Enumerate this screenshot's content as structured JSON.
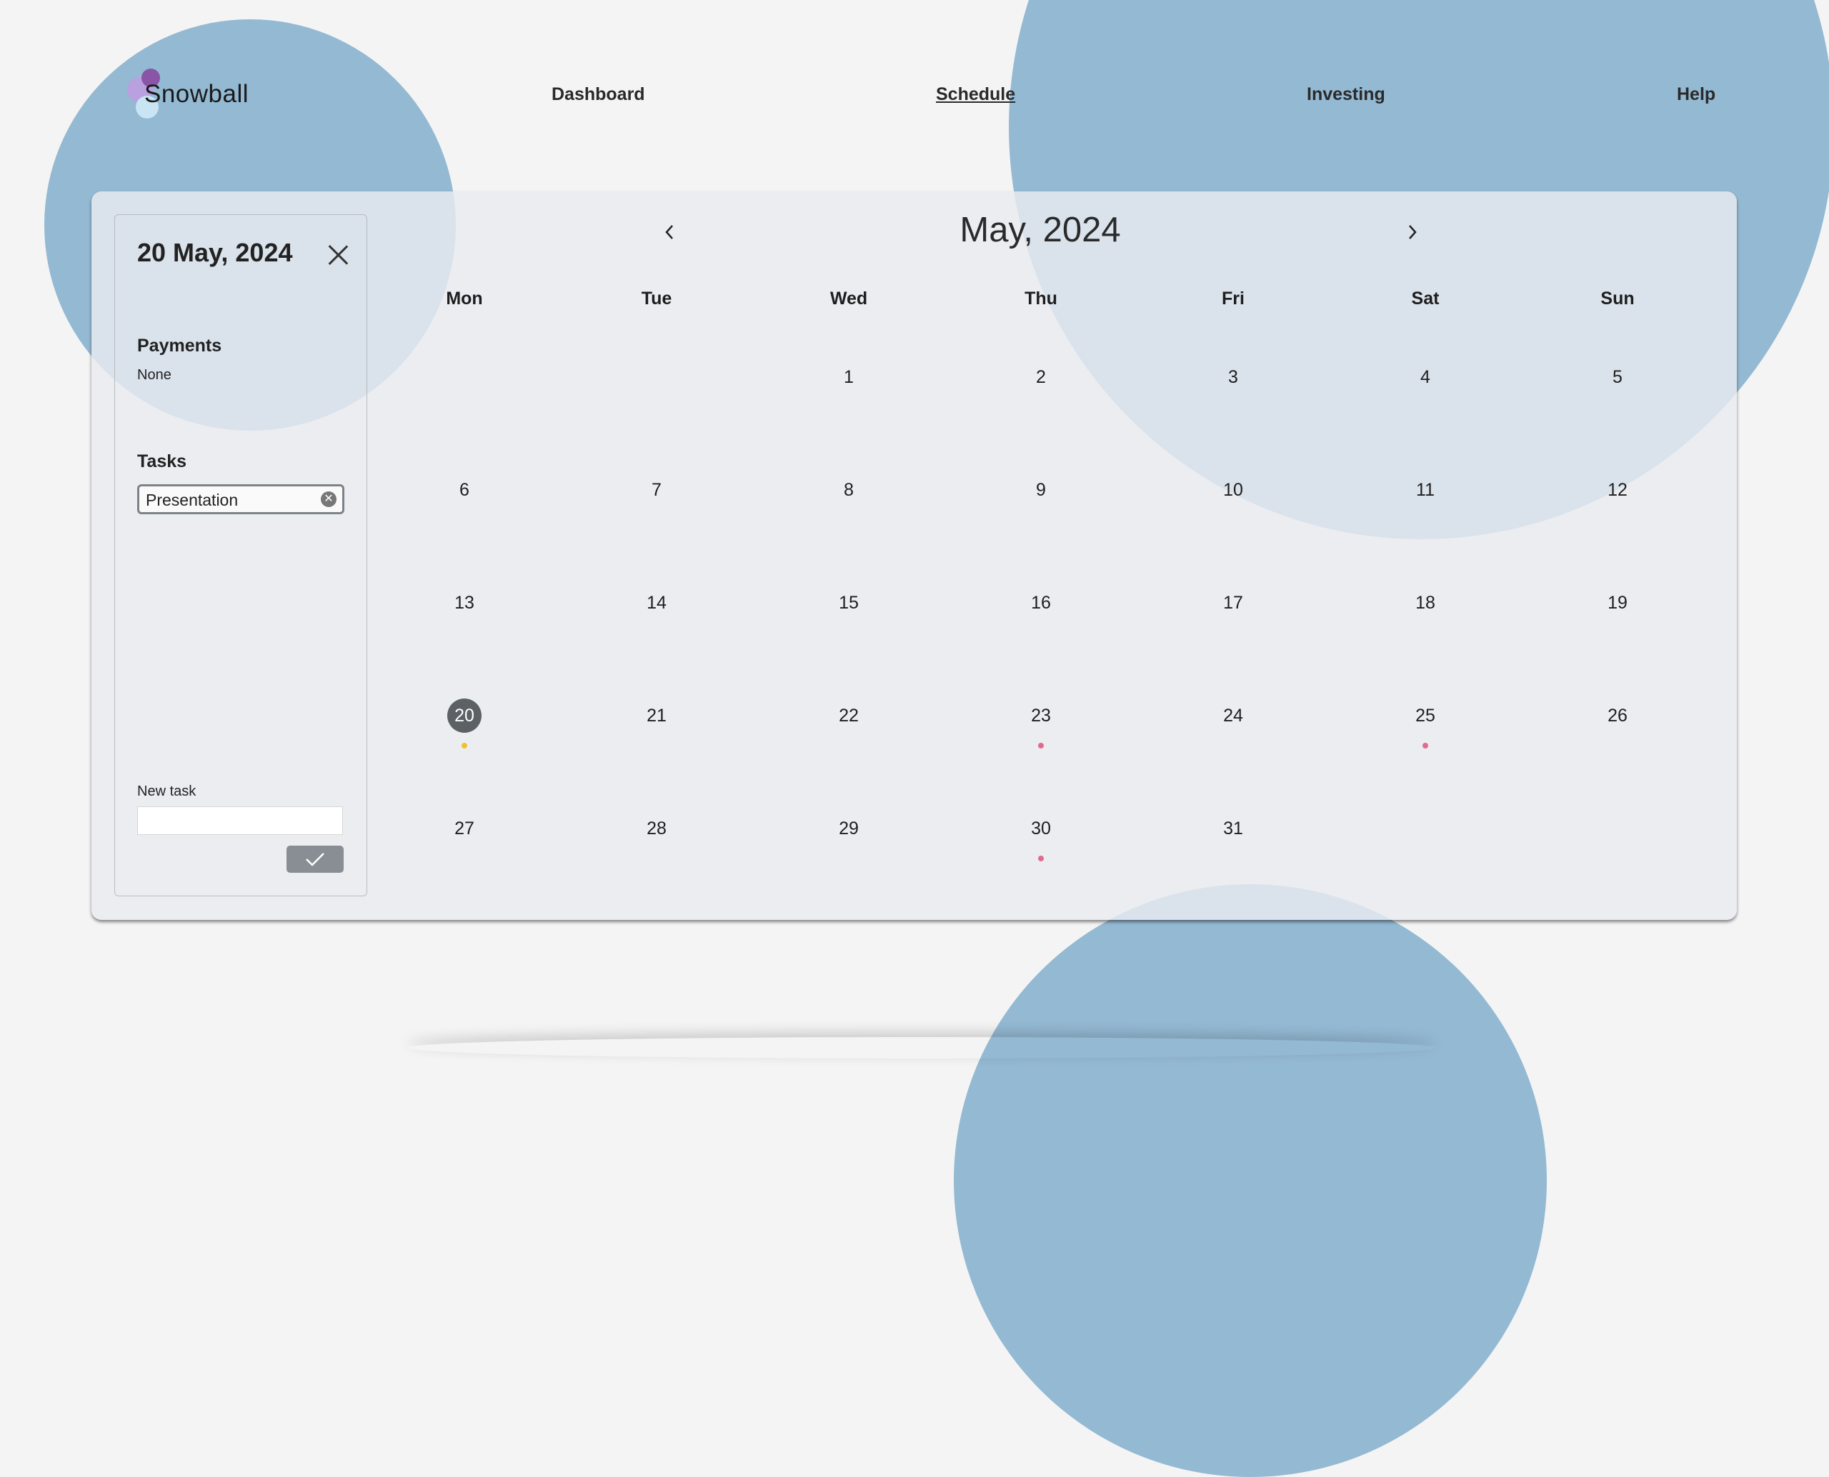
{
  "app": {
    "logo_text": "Snowball"
  },
  "nav": {
    "items": [
      {
        "label": "Dashboard",
        "active": false
      },
      {
        "label": "Schedule",
        "active": true
      },
      {
        "label": "Investing",
        "active": false
      },
      {
        "label": "Help",
        "active": false
      }
    ]
  },
  "panel": {
    "date": "20 May, 2024",
    "close_icon": "close-icon",
    "payments_title": "Payments",
    "payments_value": "None",
    "tasks_title": "Tasks",
    "tasks": [
      {
        "label": "Presentation"
      }
    ],
    "new_task_label": "New task",
    "new_task_value": "",
    "confirm_icon": "checkmark-icon"
  },
  "calendar": {
    "month_label": "May, 2024",
    "prev_icon": "chevron-left-icon",
    "next_icon": "chevron-right-icon",
    "weekdays": [
      "Mon",
      "Tue",
      "Wed",
      "Thu",
      "Fri",
      "Sat",
      "Sun"
    ],
    "weeks": [
      [
        "",
        "",
        "1",
        "2",
        "3",
        "4",
        "5"
      ],
      [
        "6",
        "7",
        "8",
        "9",
        "10",
        "11",
        "12"
      ],
      [
        "13",
        "14",
        "15",
        "16",
        "17",
        "18",
        "19"
      ],
      [
        "20",
        "21",
        "22",
        "23",
        "24",
        "25",
        "26"
      ],
      [
        "27",
        "28",
        "29",
        "30",
        "31",
        "",
        ""
      ]
    ],
    "selected_day": "20",
    "markers": [
      {
        "day": "20",
        "color": "#f2c12e"
      },
      {
        "day": "23",
        "color": "#e26a8d"
      },
      {
        "day": "25",
        "color": "#e26a8d"
      },
      {
        "day": "30",
        "color": "#e26a8d"
      }
    ]
  },
  "colors": {
    "background": "#f4f4f4",
    "blob": "#94b9d3",
    "selected_day": "#5c6166",
    "confirm_button": "#898e94"
  }
}
